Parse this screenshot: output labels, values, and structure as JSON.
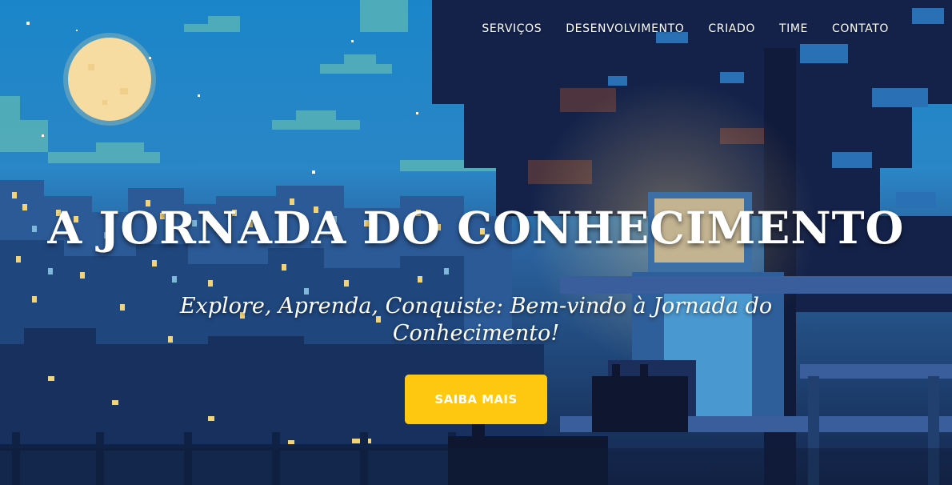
{
  "nav": {
    "items": [
      {
        "label": "SERVIÇOS"
      },
      {
        "label": "DESENVOLVIMENTO"
      },
      {
        "label": "CRIADO"
      },
      {
        "label": "TIME"
      },
      {
        "label": "CONTATO"
      }
    ]
  },
  "hero": {
    "title": "A JORNADA DO CONHECIMENTO",
    "subtitle": "Explore, Aprenda, Conquiste: Bem-vindo à Jornada do Conhecimento!",
    "cta_label": "SAIBA MAIS"
  },
  "colors": {
    "accent": "#fec810",
    "sky": "#1f8fd0",
    "night": "#16284f",
    "moon": "#f8e2a8",
    "text": "#ffffff"
  },
  "icons": [
    "moon-icon",
    "star-icon"
  ]
}
